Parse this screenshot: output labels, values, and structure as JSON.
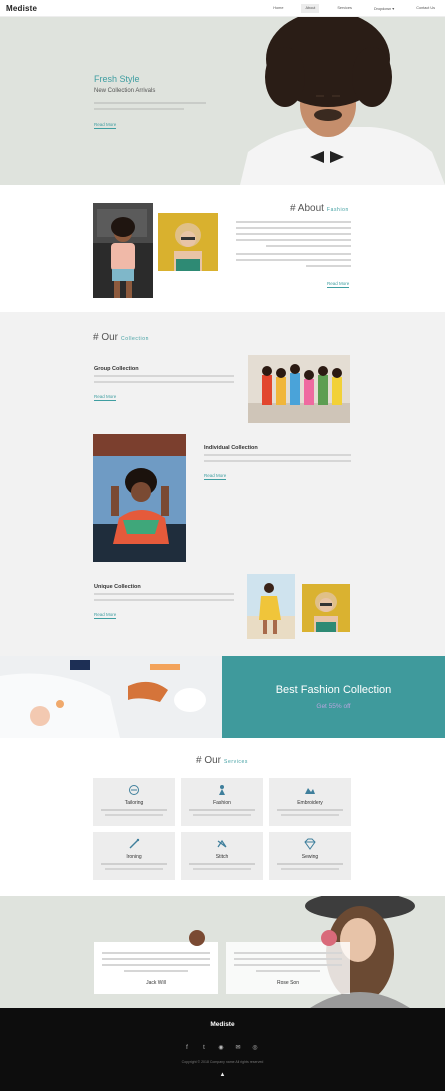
{
  "nav": {
    "logo": "Mediste",
    "items": [
      "Home",
      "About",
      "Services",
      "Dropdown ▾",
      "Contact Us"
    ]
  },
  "hero": {
    "title": "Fresh Style",
    "subtitle": "New Collection Arrivals",
    "link": "Read More"
  },
  "about": {
    "title": "# About",
    "accent": "Fashion",
    "link": "Read More"
  },
  "collection": {
    "title": "# Our",
    "accent": "Collection",
    "items": [
      {
        "heading": "Group Collection",
        "link": "Read More"
      },
      {
        "heading": "Individual Collection",
        "link": "Read More"
      },
      {
        "heading": "Unique Collection",
        "link": "Read More"
      }
    ]
  },
  "banner": {
    "title": "Best Fashion Collection",
    "subtitle": "Get 55% off",
    "accent_color": "#3f9a9c"
  },
  "services": {
    "title": "# Our",
    "accent": "Services",
    "items": [
      {
        "name": "Tailoring",
        "icon": "tailoring-icon"
      },
      {
        "name": "Fashion",
        "icon": "fashion-icon"
      },
      {
        "name": "Embroidery",
        "icon": "embroidery-icon"
      },
      {
        "name": "Ironing",
        "icon": "ironing-icon"
      },
      {
        "name": "Stitch",
        "icon": "stitch-icon"
      },
      {
        "name": "Sewing",
        "icon": "sewing-icon"
      }
    ]
  },
  "testimonials": [
    {
      "name": "Jack Will"
    },
    {
      "name": "Rose Son"
    }
  ],
  "footer": {
    "title": "Mediste",
    "social_icons": [
      "facebook-icon",
      "twitter-icon",
      "rss-icon",
      "mail-icon",
      "instagram-icon"
    ],
    "copyright": "Copyright © 2018 Company name All rights reserved",
    "back_to_top_icon": "arrow-up-icon"
  }
}
